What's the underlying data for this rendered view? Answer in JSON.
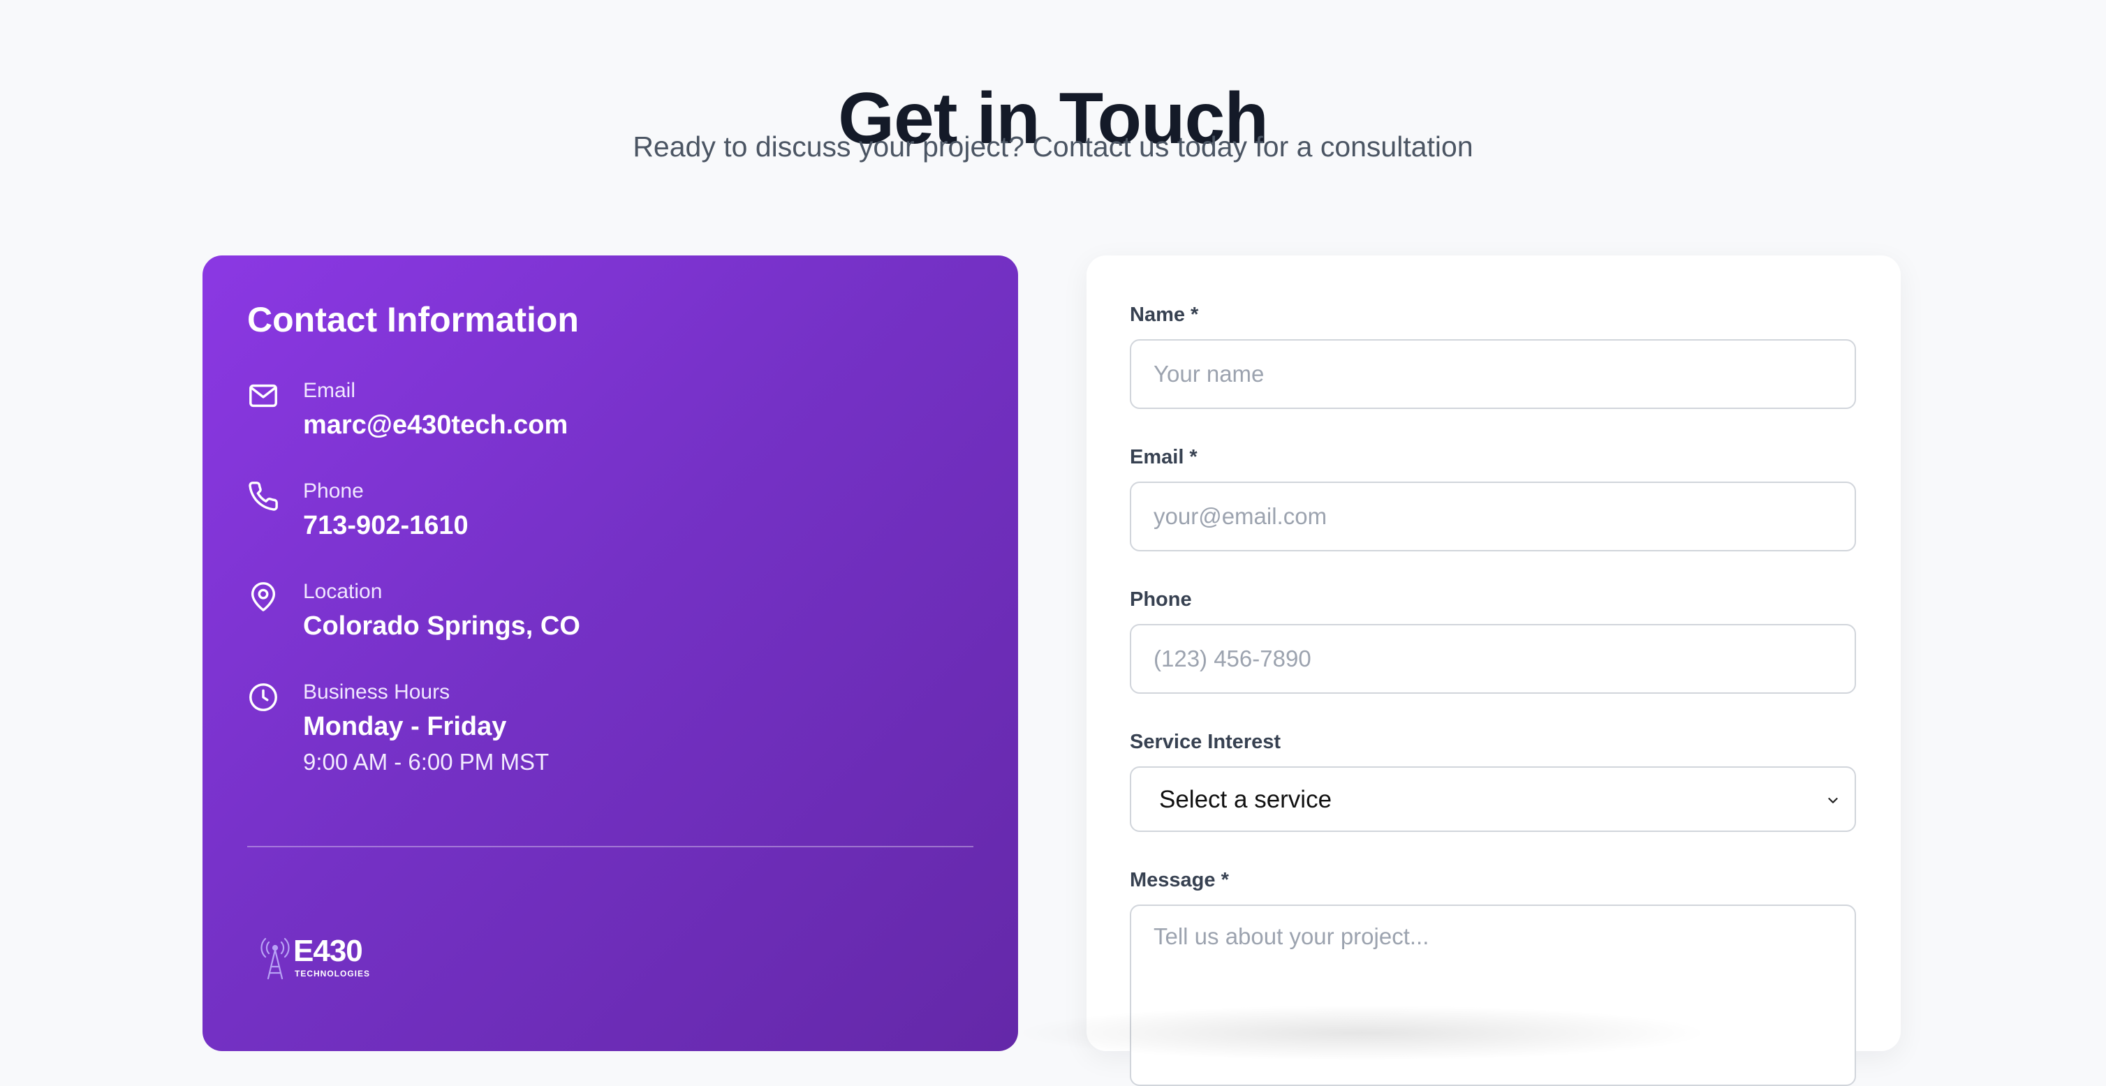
{
  "header": {
    "title": "Get in Touch",
    "subtitle": "Ready to discuss your project? Contact us today for a consultation"
  },
  "contact_info": {
    "title": "Contact Information",
    "items": [
      {
        "icon": "mail-icon",
        "label": "Email",
        "value": "marc@e430tech.com"
      },
      {
        "icon": "phone-icon",
        "label": "Phone",
        "value": "713-902-1610"
      },
      {
        "icon": "map-pin-icon",
        "label": "Location",
        "value": "Colorado Springs, CO"
      },
      {
        "icon": "clock-icon",
        "label": "Business Hours",
        "value": "Monday - Friday",
        "extra": "9:00 AM - 6:00 PM MST"
      }
    ],
    "logo": {
      "name": "E430",
      "tagline": "TECHNOLOGIES"
    }
  },
  "form": {
    "name": {
      "label": "Name *",
      "placeholder": "Your name",
      "value": ""
    },
    "email": {
      "label": "Email *",
      "placeholder": "your@email.com",
      "value": ""
    },
    "phone": {
      "label": "Phone",
      "placeholder": "(123) 456-7890",
      "value": ""
    },
    "service": {
      "label": "Service Interest",
      "selected": "Select a service"
    },
    "message": {
      "label": "Message *",
      "placeholder": "Tell us about your project...",
      "value": ""
    }
  },
  "colors": {
    "accent_gradient_start": "#8b38e3",
    "accent_gradient_end": "#6428a8",
    "background": "#f8f9fb",
    "title": "#141a28"
  }
}
